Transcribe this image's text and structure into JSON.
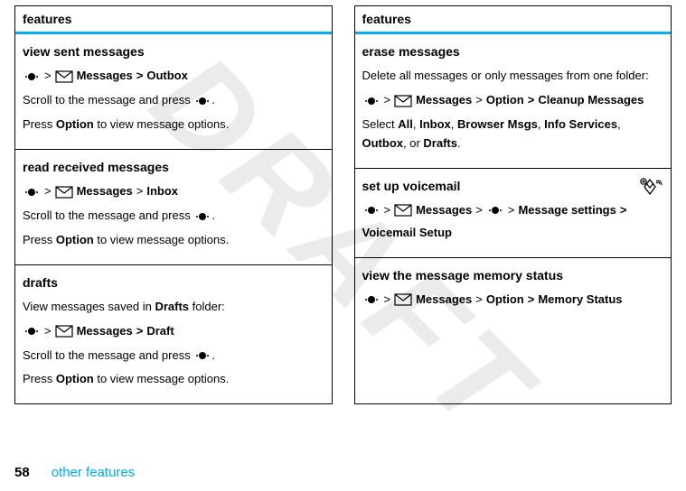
{
  "watermark": "DRAFT",
  "header": "features",
  "footer": {
    "page": "58",
    "label": "other features"
  },
  "left": {
    "s0": {
      "title": "view sent messages",
      "p_msgs": "Messages",
      "p_dest": "Outbox",
      "line1a": "Scroll to the message and press ",
      "line1b": ".",
      "line2a": "Press ",
      "line2b": "Option",
      "line2c": " to view message options."
    },
    "s1": {
      "title": "read received messages",
      "p_msgs": "Messages",
      "p_dest": "Inbox",
      "line1a": "Scroll to the message and press ",
      "line1b": ".",
      "line2a": "Press ",
      "line2b": "Option",
      "line2c": " to view message options."
    },
    "s2": {
      "title": "drafts",
      "introA": "View messages saved in ",
      "introB": "Drafts",
      "introC": " folder:",
      "p_msgs": "Messages",
      "p_dest": "Draft",
      "line1a": "Scroll to the message and press ",
      "line1b": ".",
      "line2a": "Press ",
      "line2b": "Option",
      "line2c": " to view message options."
    }
  },
  "right": {
    "s0": {
      "title": "erase messages",
      "intro": "Delete all messages or only messages from one folder:",
      "p_msgs": "Messages",
      "p_mid": "Option",
      "p_dest": "Cleanup Messages",
      "selA": "Select ",
      "selB": "All",
      "selC": ", ",
      "selD": "Inbox",
      "selE": ", ",
      "selF": "Browser Msgs",
      "selG": ", ",
      "selH": "Info Services",
      "selI": ", ",
      "selJ": "Outbox",
      "selK": ", or ",
      "selL": "Drafts",
      "selM": "."
    },
    "s1": {
      "title": "set up voicemail",
      "p_msgs": "Messages",
      "p_mid": "Message settings",
      "p_dest": "Voicemail Setup"
    },
    "s2": {
      "title": "view the message memory status",
      "p_msgs": "Messages",
      "p_mid": "Option",
      "p_dest": "Memory Status"
    }
  },
  "sep": ">"
}
